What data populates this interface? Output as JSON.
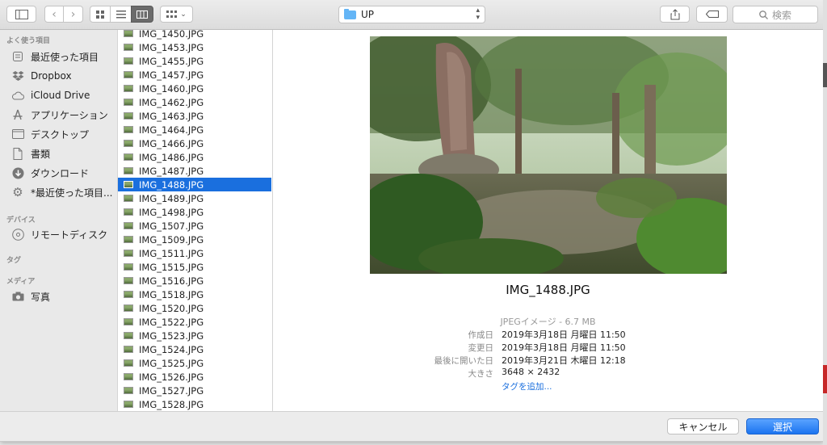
{
  "toolbar": {
    "path": "UP",
    "search_placeholder": "検索"
  },
  "sidebar": {
    "sections": [
      {
        "title": "よく使う項目",
        "items": [
          {
            "label": "最近使った項目",
            "icon": "recents-icon"
          },
          {
            "label": "Dropbox",
            "icon": "dropbox-icon"
          },
          {
            "label": "iCloud Drive",
            "icon": "cloud-icon"
          },
          {
            "label": "アプリケーション",
            "icon": "applications-icon"
          },
          {
            "label": "デスクトップ",
            "icon": "desktop-icon"
          },
          {
            "label": "書類",
            "icon": "documents-icon"
          },
          {
            "label": "ダウンロード",
            "icon": "downloads-icon"
          },
          {
            "label": "*最近使った項目...",
            "icon": "gear-icon"
          }
        ]
      },
      {
        "title": "デバイス",
        "items": [
          {
            "label": "リモートディスク",
            "icon": "disc-icon"
          }
        ]
      },
      {
        "title": "タグ",
        "items": []
      },
      {
        "title": "メディア",
        "items": [
          {
            "label": "写真",
            "icon": "camera-icon"
          }
        ]
      }
    ]
  },
  "files": [
    "IMG_1450.JPG",
    "IMG_1453.JPG",
    "IMG_1455.JPG",
    "IMG_1457.JPG",
    "IMG_1460.JPG",
    "IMG_1462.JPG",
    "IMG_1463.JPG",
    "IMG_1464.JPG",
    "IMG_1466.JPG",
    "IMG_1486.JPG",
    "IMG_1487.JPG",
    "IMG_1488.JPG",
    "IMG_1489.JPG",
    "IMG_1498.JPG",
    "IMG_1507.JPG",
    "IMG_1509.JPG",
    "IMG_1511.JPG",
    "IMG_1515.JPG",
    "IMG_1516.JPG",
    "IMG_1518.JPG",
    "IMG_1520.JPG",
    "IMG_1522.JPG",
    "IMG_1523.JPG",
    "IMG_1524.JPG",
    "IMG_1525.JPG",
    "IMG_1526.JPG",
    "IMG_1527.JPG",
    "IMG_1528.JPG"
  ],
  "selected_file": "IMG_1488.JPG",
  "preview": {
    "title": "IMG_1488.JPG",
    "kind": "JPEGイメージ - 6.7 MB",
    "meta": [
      {
        "label": "作成日",
        "value": "2019年3月18日 月曜日 11:50"
      },
      {
        "label": "変更日",
        "value": "2019年3月18日 月曜日 11:50"
      },
      {
        "label": "最後に開いた日",
        "value": "2019年3月21日 木曜日 12:18"
      },
      {
        "label": "大きさ",
        "value": "3648 × 2432"
      }
    ],
    "add_tag": "タグを追加..."
  },
  "buttons": {
    "cancel": "キャンセル",
    "ok": "選択"
  },
  "colors": {
    "selection": "#1a6fde",
    "primary_button": "#1b74f0"
  }
}
